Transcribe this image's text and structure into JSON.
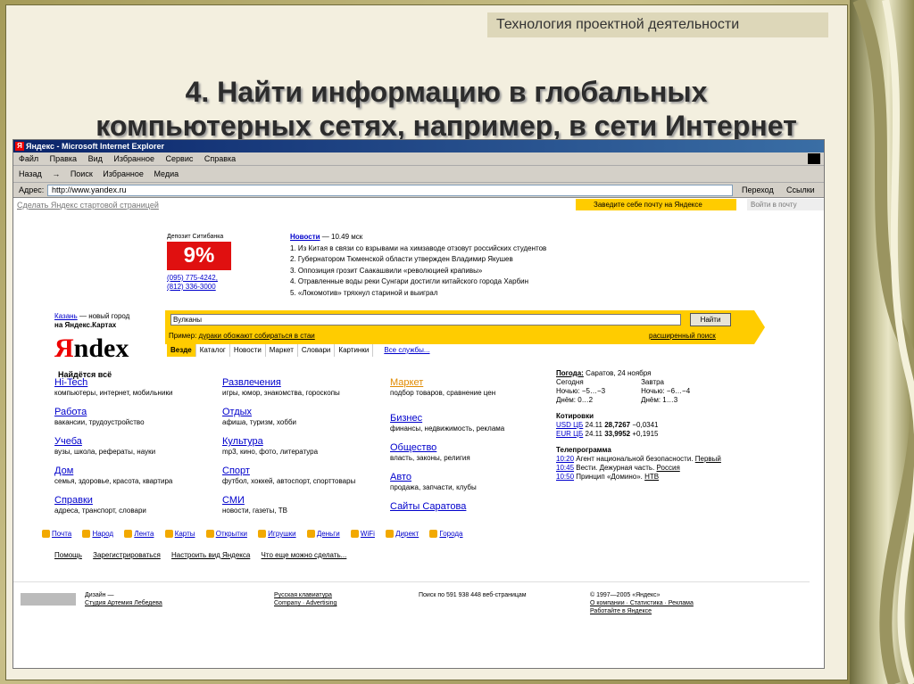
{
  "slide": {
    "subject": "Технология проектной деятельности",
    "title_line1": "4. Найти информацию в глобальных",
    "title_line2": "компьютерных сетях, например, в сети Интернет"
  },
  "browser": {
    "window_title": "Яндекс - Microsoft Internet Explorer",
    "menu": [
      "Файл",
      "Правка",
      "Вид",
      "Избранное",
      "Сервис",
      "Справка"
    ],
    "toolbar": [
      "Назад",
      "→",
      "Поиск",
      "Избранное",
      "Медиа"
    ],
    "address_label": "Адрес:",
    "address_value": "http://www.yandex.ru",
    "go_label": "Переход",
    "links_label": "Ссылки"
  },
  "yandex": {
    "make_home": "Сделать Яндекс стартовой страницей",
    "mail_promo": "Заведите себе почту на Яндексе",
    "login": "Войти в почту",
    "ad_title": "Депозит Ситибанка",
    "ad_value": "9%",
    "ad_phone1": "(095) 775-4242,",
    "ad_phone2": "(812) 336-3000",
    "city_link": "Казань",
    "city_text": "— новый город",
    "city_text2": "на Яндекс.Картах",
    "logo_red": "Я",
    "logo_rest": "ndex",
    "slogan": "Найдётся всё",
    "news_title": "Новости",
    "news_time": "— 10.49 мск",
    "news": [
      "1. Из Китая в связи со взрывами на химзаводе отзовут российских студентов",
      "2. Губернатором Тюменской области утвержден Владимир Якушев",
      "3. Оппозиция грозит Саакашвили «революцией крапивы»",
      "4. Отравленные воды реки Сунгари достигли китайского города Харбин",
      "5. «Локомотив» тряхнул стариной и выиграл"
    ],
    "search_value": "Вулканы",
    "search_button": "Найти",
    "example_label": "Пример:",
    "example_value": "дураки обожают собираться в стаи",
    "advanced": "расширенный поиск",
    "tabs": [
      "Везде",
      "Каталог",
      "Новости",
      "Маркет",
      "Словари",
      "Картинки",
      "Все службы..."
    ],
    "categories": [
      {
        "t": "Hi-Tech",
        "d": "компьютеры, интернет, мобильники"
      },
      {
        "t": "Работа",
        "d": "вакансии, трудоустройство"
      },
      {
        "t": "Учеба",
        "d": "вузы, школа, рефераты, науки"
      },
      {
        "t": "Дом",
        "d": "семья, здоровье, красота, квартира"
      },
      {
        "t": "Справки",
        "d": "адреса, транспорт, словари"
      },
      {
        "t": "Развлечения",
        "d": "игры, юмор, знакомства, гороскопы"
      },
      {
        "t": "Отдых",
        "d": "афиша, туризм, хобби"
      },
      {
        "t": "Культура",
        "d": "mp3, кино, фото, литература"
      },
      {
        "t": "Спорт",
        "d": "футбол, хоккей, автоспорт, спорттовары"
      },
      {
        "t": "СМИ",
        "d": "новости, газеты, ТВ"
      },
      {
        "t": "Маркет",
        "d": "подбор товаров, сравнение цен"
      },
      {
        "t": "Бизнес",
        "d": "финансы, недвижимость, реклама"
      },
      {
        "t": "Общество",
        "d": "власть, законы, религия"
      },
      {
        "t": "Авто",
        "d": "продажа, запчасти, клубы"
      },
      {
        "t": "Сайты Саратова",
        "d": ""
      }
    ],
    "weather_title": "Погода:",
    "weather_city": "Саратов, 24 ноября",
    "today": "Сегодня",
    "tomorrow": "Завтра",
    "night_today": "Ночью: −5…−3",
    "day_today": "Днём: 0…2",
    "night_tomorrow": "Ночью: −6…−4",
    "day_tomorrow": "Днём: 1…3",
    "rates_title": "Котировки",
    "rates": [
      {
        "n": "USD ЦБ",
        "d": "24.11",
        "v": "28,7267",
        "c": "−0,0341"
      },
      {
        "n": "EUR ЦБ",
        "d": "24.11",
        "v": "33,9952",
        "c": "+0,1915"
      }
    ],
    "tv_title": "Телепрограмма",
    "tv": [
      {
        "t": "10:20",
        "p": "Агент национальной безопасности.",
        "ch": "Первый"
      },
      {
        "t": "10:45",
        "p": "Вести. Дежурная часть.",
        "ch": "Россия"
      },
      {
        "t": "10:50",
        "p": "Принцип «Домино».",
        "ch": "НТВ"
      }
    ],
    "services": [
      "Почта",
      "Народ",
      "Лента",
      "Карты",
      "Открытки",
      "Игрушки",
      "Деньги",
      "WiFi",
      "Директ",
      "Города"
    ],
    "bottom_links": [
      "Помощь",
      "Зарегистрироваться",
      "Настроить вид Яндекса",
      "Что еще можно сделать..."
    ],
    "footer": {
      "design": "Дизайн —",
      "studio": "Студия Артемия Лебедева",
      "klava": "Русская клавиатура",
      "company": "Company · Advertising",
      "pages": "Поиск по 591 938 448 веб-страницам",
      "copy": "© 1997—2005 «Яндекс»",
      "about": "О компании · Статистика · Реклама",
      "jobs": "Работайте в Яндексе"
    }
  }
}
